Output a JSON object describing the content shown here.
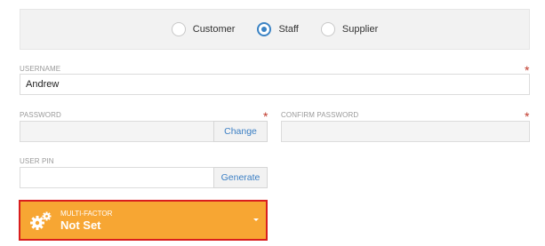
{
  "account_type": {
    "options": [
      {
        "label": "Customer",
        "checked": false
      },
      {
        "label": "Staff",
        "checked": true
      },
      {
        "label": "Supplier",
        "checked": false
      }
    ]
  },
  "username": {
    "label": "USERNAME",
    "value": "Andrew",
    "required_mark": "*"
  },
  "password": {
    "label": "PASSWORD",
    "value": "",
    "required_mark": "*",
    "button": "Change"
  },
  "confirm_password": {
    "label": "CONFIRM PASSWORD",
    "value": "",
    "required_mark": "*"
  },
  "user_pin": {
    "label": "USER PIN",
    "value": "",
    "button": "Generate"
  },
  "multi_factor": {
    "caption": "MULTI-FACTOR",
    "value": "Not Set",
    "icon": "gears-icon"
  },
  "colors": {
    "accent": "#3b83c4",
    "warning": "#f7a633",
    "highlight": "#d91e1e",
    "required": "#c0392b"
  }
}
